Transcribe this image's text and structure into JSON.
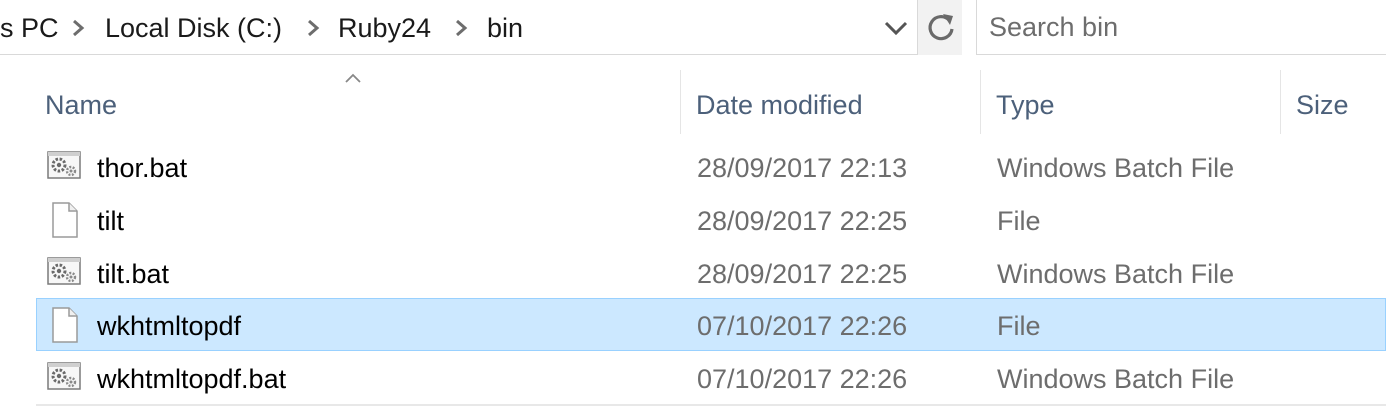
{
  "breadcrumb": {
    "items": [
      "s PC",
      "Local Disk (C:)",
      "Ruby24",
      "bin"
    ],
    "separator_icon": "chevron-right-icon"
  },
  "toolbar": {
    "history_icon": "chevron-down-icon",
    "refresh_icon": "refresh-icon"
  },
  "search": {
    "placeholder": "Search bin",
    "value": ""
  },
  "columns": {
    "sort_indicator": "sort-ascending-icon",
    "name": "Name",
    "date": "Date modified",
    "type": "Type",
    "size": "Size"
  },
  "files": [
    {
      "name": "thor.bat",
      "date": "28/09/2017 22:13",
      "type": "Windows Batch File",
      "icon": "batch-file-icon",
      "selected": false
    },
    {
      "name": "tilt",
      "date": "28/09/2017 22:25",
      "type": "File",
      "icon": "generic-file-icon",
      "selected": false
    },
    {
      "name": "tilt.bat",
      "date": "28/09/2017 22:25",
      "type": "Windows Batch File",
      "icon": "batch-file-icon",
      "selected": false
    },
    {
      "name": "wkhtmltopdf",
      "date": "07/10/2017 22:26",
      "type": "File",
      "icon": "generic-file-icon",
      "selected": true
    },
    {
      "name": "wkhtmltopdf.bat",
      "date": "07/10/2017 22:26",
      "type": "Windows Batch File",
      "icon": "batch-file-icon",
      "selected": false
    }
  ],
  "colors": {
    "selection_fill": "#cce8ff",
    "selection_border": "#99d1ff",
    "header_text": "#4c607a",
    "secondary_text": "#6d6d6d"
  }
}
